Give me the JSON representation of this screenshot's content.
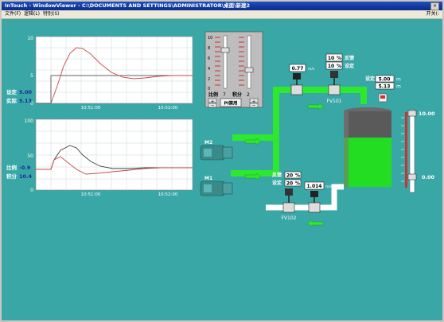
{
  "window": {
    "title": "InTouch - WindowViewer - C:\\DOCUMENTS AND SETTINGS\\ADMINISTRATOR\\桌面\\新建2",
    "close_label": "×"
  },
  "menu": {
    "items": [
      "文件(F)",
      "逻辑(L)",
      "特别(S)"
    ],
    "right_item": "开关(:"
  },
  "trend1": {
    "y_ticks": [
      "10",
      "5",
      "0"
    ],
    "x_ticks": [
      "10:51:00",
      "10:52:00"
    ],
    "sp_label": "设定",
    "sp_value": "5.00",
    "pv_label": "实际",
    "pv_value": "5.13",
    "colors": {
      "step": "#606060",
      "response": "#c8484c"
    }
  },
  "trend2": {
    "y_ticks": [
      "100",
      "50",
      "0"
    ],
    "x_ticks": [
      "10:51:00",
      "10:52:00"
    ],
    "p_label": "比例",
    "p_value": "-0.9",
    "i_label": "积分",
    "i_value": "10.4",
    "colors": {
      "p": "#c8484c",
      "i": "#404040"
    }
  },
  "pi_panel": {
    "scale": [
      "10",
      "8",
      "6",
      "4",
      "2",
      "0"
    ],
    "p_label": "比例",
    "p_value": "7",
    "i_label": "积分",
    "i_value": "2",
    "mode_button": "PI禁用",
    "plus": "+",
    "minus": "−"
  },
  "process": {
    "flow_top": {
      "value": "0.77",
      "unit": "m/s"
    },
    "flow_bottom": {
      "value": "1.014",
      "unit": "m/s"
    },
    "valve_top": {
      "name": "FV101",
      "fb_value": "10",
      "sp_value": "10",
      "unit": "%",
      "fb_label": "反馈",
      "sp_label": "设定"
    },
    "valve_bottom": {
      "name": "FV102",
      "fb_value": "20",
      "sp_value": "20",
      "unit": "%",
      "fb_label": "反馈",
      "sp_label": "设定"
    },
    "level": {
      "sp_label": "设定",
      "sp_value": "5.00",
      "pv_value": "5.13",
      "unit": "m"
    },
    "pumps": [
      "M2",
      "M1"
    ],
    "bar_top": "10.00",
    "bar_bottom": "0.00",
    "colors": {
      "pipe": "#2ee82e",
      "water": "#22dd22",
      "tank": "#5a5a5a",
      "bar": "#d03030"
    }
  }
}
